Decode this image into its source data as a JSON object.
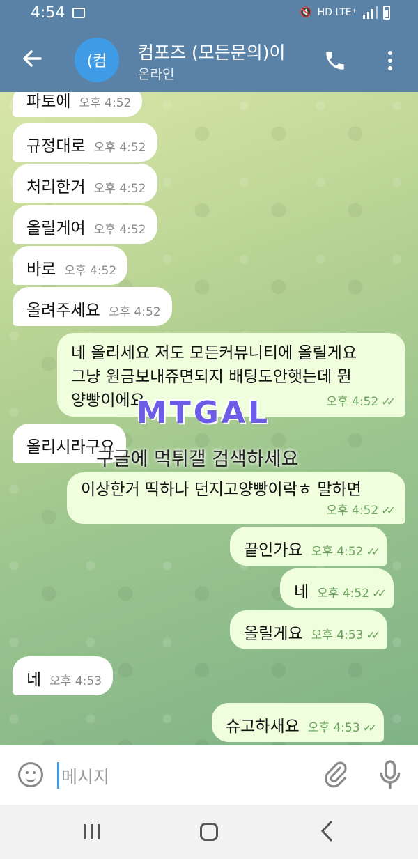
{
  "status": {
    "time": "4:54",
    "indicators": "HD LTE⁺"
  },
  "header": {
    "back_icon": "arrow-left-icon",
    "avatar_text": "(컴",
    "title": "컴포즈 (모든문의)이",
    "subtitle": "온라인"
  },
  "messages": [
    {
      "dir": "in",
      "text": "파토에",
      "time": "오후 4:52"
    },
    {
      "dir": "in",
      "text": "규정대로",
      "time": "오후 4:52"
    },
    {
      "dir": "in",
      "text": "처리한거",
      "time": "오후 4:52"
    },
    {
      "dir": "in",
      "text": "올릴게여",
      "time": "오후 4:52"
    },
    {
      "dir": "in",
      "text": "바로",
      "time": "오후 4:52"
    },
    {
      "dir": "in",
      "text": "올려주세요",
      "time": "오후 4:52"
    },
    {
      "dir": "out",
      "lines": [
        "네 올리세요 저도 모든커뮤니티에 올릴게요",
        "그냥 원금보내쥬면되지 배팅도안햇는데 뭔",
        "양빵이에요"
      ],
      "time": "오후 4:52"
    },
    {
      "dir": "in",
      "text": "올리시라구요",
      "time": ""
    },
    {
      "dir": "out",
      "text": "이상한거 띡하나 던지고양빵이락ㅎ 말하면",
      "time": "오후 4:52"
    },
    {
      "dir": "out",
      "text": "끝인가요",
      "time": "오후 4:52"
    },
    {
      "dir": "out",
      "text": "네",
      "time": "오후 4:52"
    },
    {
      "dir": "out",
      "text": "올릴게요",
      "time": "오후 4:53"
    },
    {
      "dir": "in",
      "text": "네",
      "time": "오후 4:53"
    },
    {
      "dir": "out",
      "text": "슈고하새요",
      "time": "오후 4:53"
    }
  ],
  "watermark": {
    "logo": "MTGAL",
    "text": "구글에 먹튀갤 검색하세요"
  },
  "input": {
    "placeholder": "메시지"
  },
  "colors": {
    "header": "#5a82a6",
    "out_bubble": "#effedd",
    "in_bubble": "#ffffff",
    "check": "#6aa35e"
  }
}
